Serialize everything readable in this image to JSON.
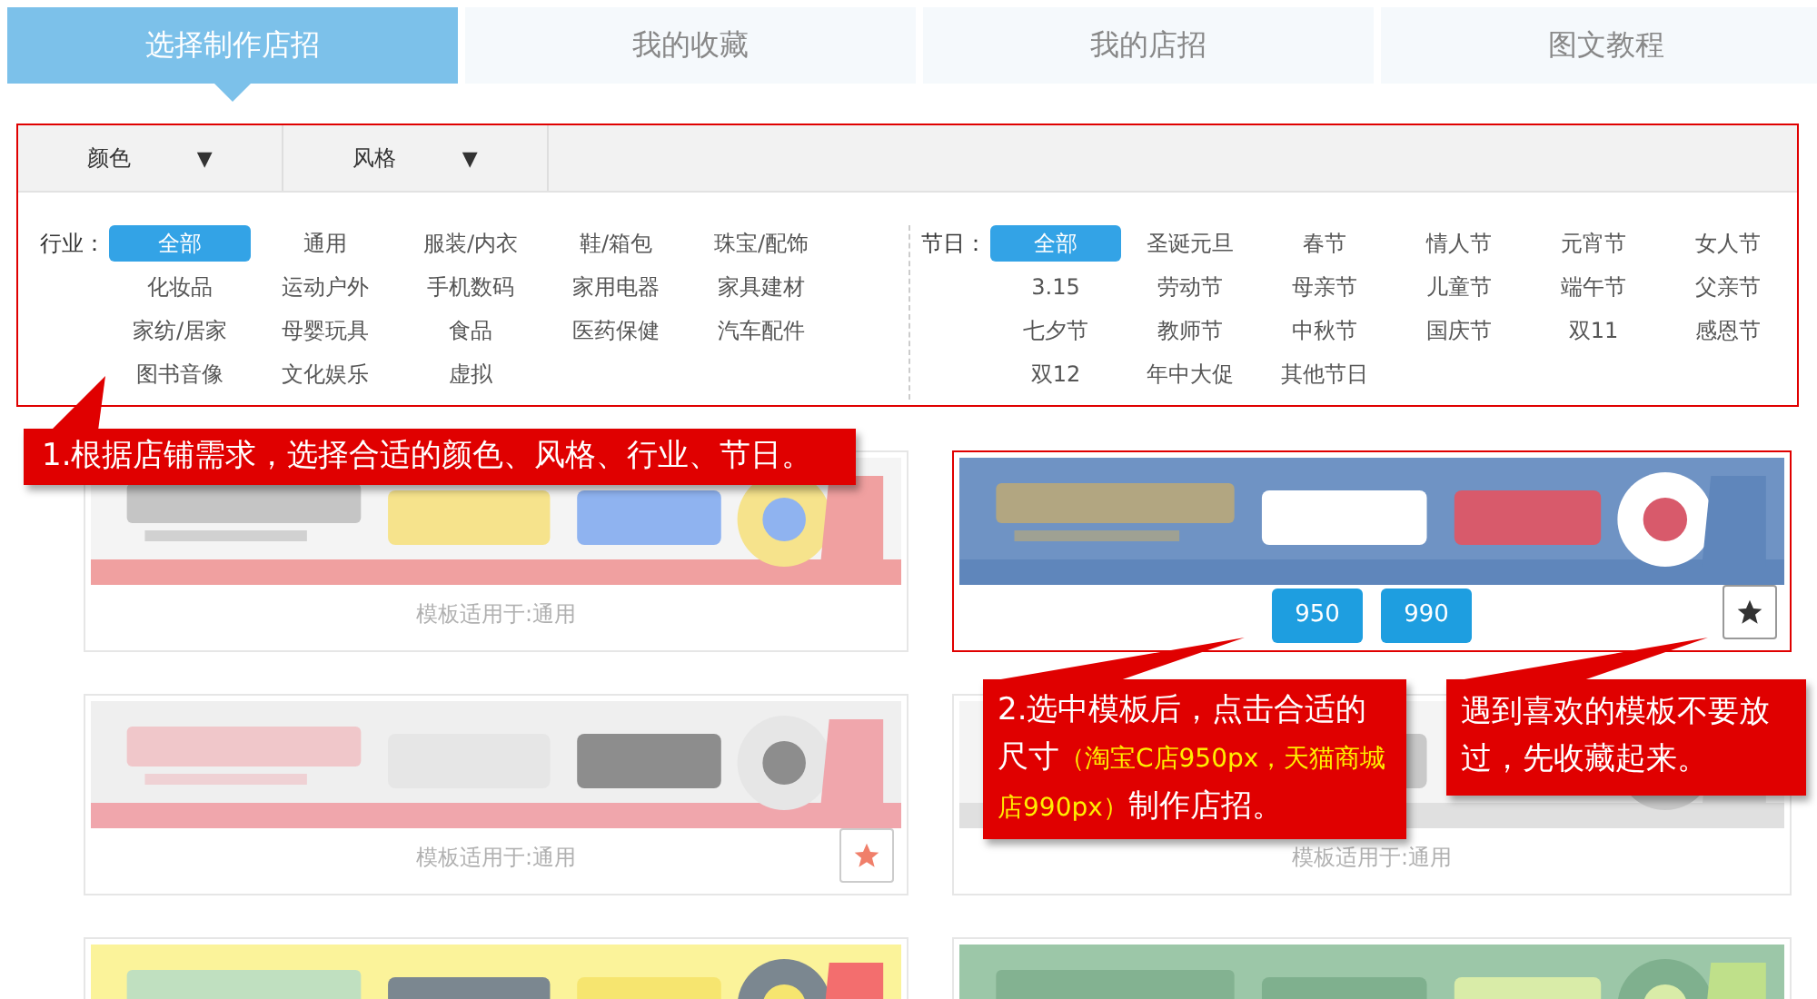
{
  "tabs": [
    {
      "label": "选择制作店招",
      "selected": true
    },
    {
      "label": "我的收藏",
      "selected": false
    },
    {
      "label": "我的店招",
      "selected": false
    },
    {
      "label": "图文教程",
      "selected": false
    }
  ],
  "filters": {
    "dropdowns": [
      {
        "label": "颜色",
        "arrow": "▼"
      },
      {
        "label": "风格",
        "arrow": "▼"
      }
    ],
    "groups": [
      {
        "label": "行业：",
        "options": [
          {
            "label": "全部",
            "selected": true
          },
          {
            "label": "通用",
            "selected": false
          },
          {
            "label": "服装/内衣",
            "selected": false
          },
          {
            "label": "鞋/箱包",
            "selected": false
          },
          {
            "label": "珠宝/配饰",
            "selected": false
          },
          {
            "label": "化妆品",
            "selected": false
          },
          {
            "label": "运动户外",
            "selected": false
          },
          {
            "label": "手机数码",
            "selected": false
          },
          {
            "label": "家用电器",
            "selected": false
          },
          {
            "label": "家具建材",
            "selected": false
          },
          {
            "label": "家纺/居家",
            "selected": false
          },
          {
            "label": "母婴玩具",
            "selected": false
          },
          {
            "label": "食品",
            "selected": false
          },
          {
            "label": "医药保健",
            "selected": false
          },
          {
            "label": "汽车配件",
            "selected": false
          },
          {
            "label": "图书音像",
            "selected": false
          },
          {
            "label": "文化娱乐",
            "selected": false
          },
          {
            "label": "虚拟",
            "selected": false
          }
        ]
      },
      {
        "label": "节日：",
        "options": [
          {
            "label": "全部",
            "selected": true
          },
          {
            "label": "圣诞元旦",
            "selected": false
          },
          {
            "label": "春节",
            "selected": false
          },
          {
            "label": "情人节",
            "selected": false
          },
          {
            "label": "元宵节",
            "selected": false
          },
          {
            "label": "女人节",
            "selected": false
          },
          {
            "label": "3.15",
            "selected": false
          },
          {
            "label": "劳动节",
            "selected": false
          },
          {
            "label": "母亲节",
            "selected": false
          },
          {
            "label": "儿童节",
            "selected": false
          },
          {
            "label": "端午节",
            "selected": false
          },
          {
            "label": "父亲节",
            "selected": false
          },
          {
            "label": "七夕节",
            "selected": false
          },
          {
            "label": "教师节",
            "selected": false
          },
          {
            "label": "中秋节",
            "selected": false
          },
          {
            "label": "国庆节",
            "selected": false
          },
          {
            "label": "双11",
            "selected": false
          },
          {
            "label": "感恩节",
            "selected": false
          },
          {
            "label": "双12",
            "selected": false
          },
          {
            "label": "年中大促",
            "selected": false
          },
          {
            "label": "其他节日",
            "selected": false
          }
        ]
      }
    ]
  },
  "cards": [
    {
      "picture": {
        "kind": "picture"
      },
      "selected": false,
      "caption": "模板适用于:通用",
      "favorite_button": false
    },
    {
      "picture": {
        "kind": "picture"
      },
      "selected": true,
      "sizes": [
        "950",
        "990"
      ],
      "favorite_button": true
    },
    {
      "picture": {
        "kind": "picture"
      },
      "selected": false,
      "caption": "模板适用于:通用",
      "favorite_button": true
    },
    {
      "picture": {
        "kind": "picture"
      },
      "selected": false,
      "caption": "模板适用于:通用",
      "favorite_button": false
    },
    {
      "picture": {
        "kind": "picture"
      },
      "selected": false
    },
    {
      "picture": {
        "kind": "picture"
      },
      "selected": false
    }
  ],
  "callouts": [
    {
      "segments": [
        {
          "text": "1.根据店铺需求，选择合适的颜色、风格、行业、节日。",
          "highlight": false
        }
      ]
    },
    {
      "segments": [
        {
          "text": "2.选中模板后，点击合适的尺寸",
          "highlight": false
        },
        {
          "text": "（淘宝C店950px，天猫商城店990px）",
          "highlight": true
        },
        {
          "text": "制作店招。",
          "highlight": false
        }
      ]
    },
    {
      "segments": [
        {
          "text": "遇到喜欢的模板不要放过，先收藏起来。",
          "highlight": false
        }
      ]
    }
  ]
}
